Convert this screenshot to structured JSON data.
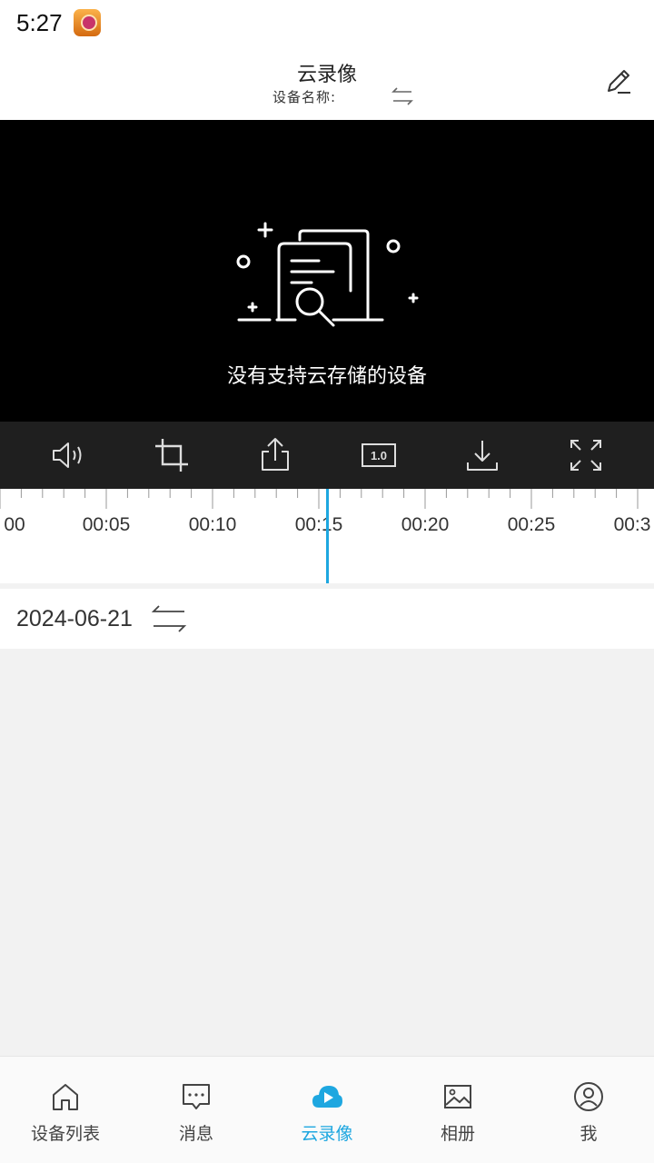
{
  "status_bar": {
    "time": "5:27"
  },
  "header": {
    "title": "云录像",
    "device_name_label": "设备名称:"
  },
  "video": {
    "empty_message": "没有支持云存储的设备"
  },
  "toolbar": {
    "items": [
      {
        "name": "volume",
        "icon": "speaker-icon"
      },
      {
        "name": "crop",
        "icon": "crop-icon"
      },
      {
        "name": "share",
        "icon": "share-icon"
      },
      {
        "name": "speed",
        "icon": "speed-icon",
        "label": "1.0"
      },
      {
        "name": "download",
        "icon": "download-icon"
      },
      {
        "name": "fullscreen",
        "icon": "fullscreen-icon"
      }
    ]
  },
  "timeline": {
    "labels": [
      "00",
      "00:05",
      "00:10",
      "00:15",
      "00:20",
      "00:25",
      "00:3"
    ]
  },
  "date_bar": {
    "date": "2024-06-21"
  },
  "bottom_nav": {
    "items": [
      {
        "label": "设备列表",
        "icon": "home-icon",
        "active": false
      },
      {
        "label": "消息",
        "icon": "message-icon",
        "active": false
      },
      {
        "label": "云录像",
        "icon": "cloud-play-icon",
        "active": true
      },
      {
        "label": "相册",
        "icon": "gallery-icon",
        "active": false
      },
      {
        "label": "我",
        "icon": "user-icon",
        "active": false
      }
    ]
  },
  "colors": {
    "accent": "#1ea7e0",
    "toolbar_bg": "#1f1f1f",
    "video_bg": "#000000"
  }
}
